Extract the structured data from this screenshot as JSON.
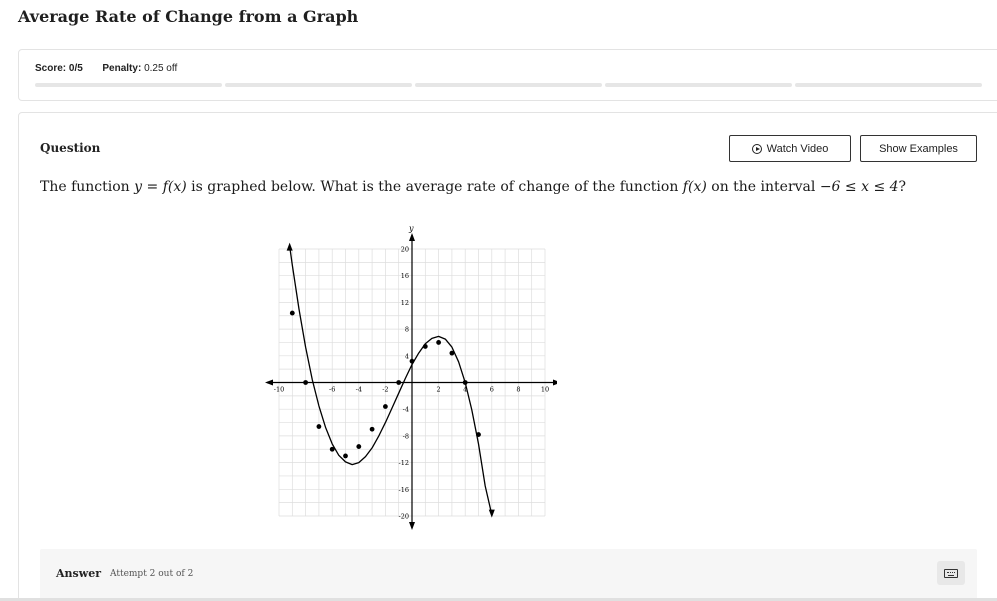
{
  "page": {
    "title": "Average Rate of Change from a Graph"
  },
  "score": {
    "score_label": "Score:",
    "score_value": "0/5",
    "penalty_label": "Penalty:",
    "penalty_value": "0.25 off",
    "progress_segments": 5
  },
  "question": {
    "heading": "Question",
    "watch_video_label": "Watch Video",
    "show_examples_label": "Show Examples",
    "text_part1": "The function ",
    "math_eq": "y = f(x)",
    "text_part2": " is graphed below. What is the average rate of change of the function ",
    "math_fx": "f(x)",
    "text_part3": " on the interval ",
    "math_interval": "−6 ≤ x ≤ 4",
    "text_part4": "?"
  },
  "chart_data": {
    "type": "line",
    "xlabel": "x",
    "ylabel": "y",
    "xlim": [
      -10,
      10
    ],
    "ylim": [
      -20,
      20
    ],
    "grid": true,
    "x_ticks": [
      -10,
      -6,
      -4,
      -2,
      2,
      4,
      6,
      8,
      10
    ],
    "y_ticks": [
      20,
      16,
      12,
      8,
      4,
      -4,
      -8,
      -12,
      -16,
      -20
    ],
    "x_tick_labels": [
      "-10",
      "-6",
      "-4",
      "-2",
      "2",
      "4",
      "6",
      "8",
      "10"
    ],
    "y_tick_labels": [
      "20",
      "16",
      "12",
      "8",
      "4",
      "-4",
      "-8",
      "-12",
      "-16",
      "-20"
    ],
    "curve": {
      "x": [
        -9.2,
        -9,
        -8.5,
        -8,
        -7.5,
        -7,
        -6.5,
        -6,
        -5.5,
        -5,
        -4.5,
        -4,
        -3.5,
        -3,
        -2.5,
        -2,
        -1.5,
        -1,
        -0.5,
        0,
        0.5,
        1,
        1.5,
        2,
        2.5,
        3,
        3.5,
        4,
        4.5,
        5,
        5.5,
        6
      ],
      "y": [
        20.5,
        17.6,
        11.0,
        5.3,
        0.4,
        -3.5,
        -6.7,
        -9.2,
        -10.9,
        -11.9,
        -12.3,
        -12.0,
        -11.1,
        -9.8,
        -8.0,
        -6.0,
        -3.8,
        -1.6,
        0.6,
        2.7,
        4.4,
        5.8,
        6.6,
        6.9,
        6.5,
        5.3,
        3.1,
        0.0,
        -4.1,
        -9.2,
        -15.5,
        -19.8
      ]
    },
    "points": [
      {
        "x": -9,
        "y": 10.4
      },
      {
        "x": -8,
        "y": 0
      },
      {
        "x": -7,
        "y": -6.6
      },
      {
        "x": -6,
        "y": -10
      },
      {
        "x": -5,
        "y": -11
      },
      {
        "x": -4,
        "y": -9.6
      },
      {
        "x": -3,
        "y": -7
      },
      {
        "x": -2,
        "y": -3.6
      },
      {
        "x": -1,
        "y": 0
      },
      {
        "x": 0,
        "y": 3.2
      },
      {
        "x": 1,
        "y": 5.4
      },
      {
        "x": 2,
        "y": 6
      },
      {
        "x": 3,
        "y": 4.4
      },
      {
        "x": 4,
        "y": 0
      },
      {
        "x": 5,
        "y": -7.8
      }
    ]
  },
  "answer": {
    "label": "Answer",
    "attempt": "Attempt 2 out of 2"
  }
}
